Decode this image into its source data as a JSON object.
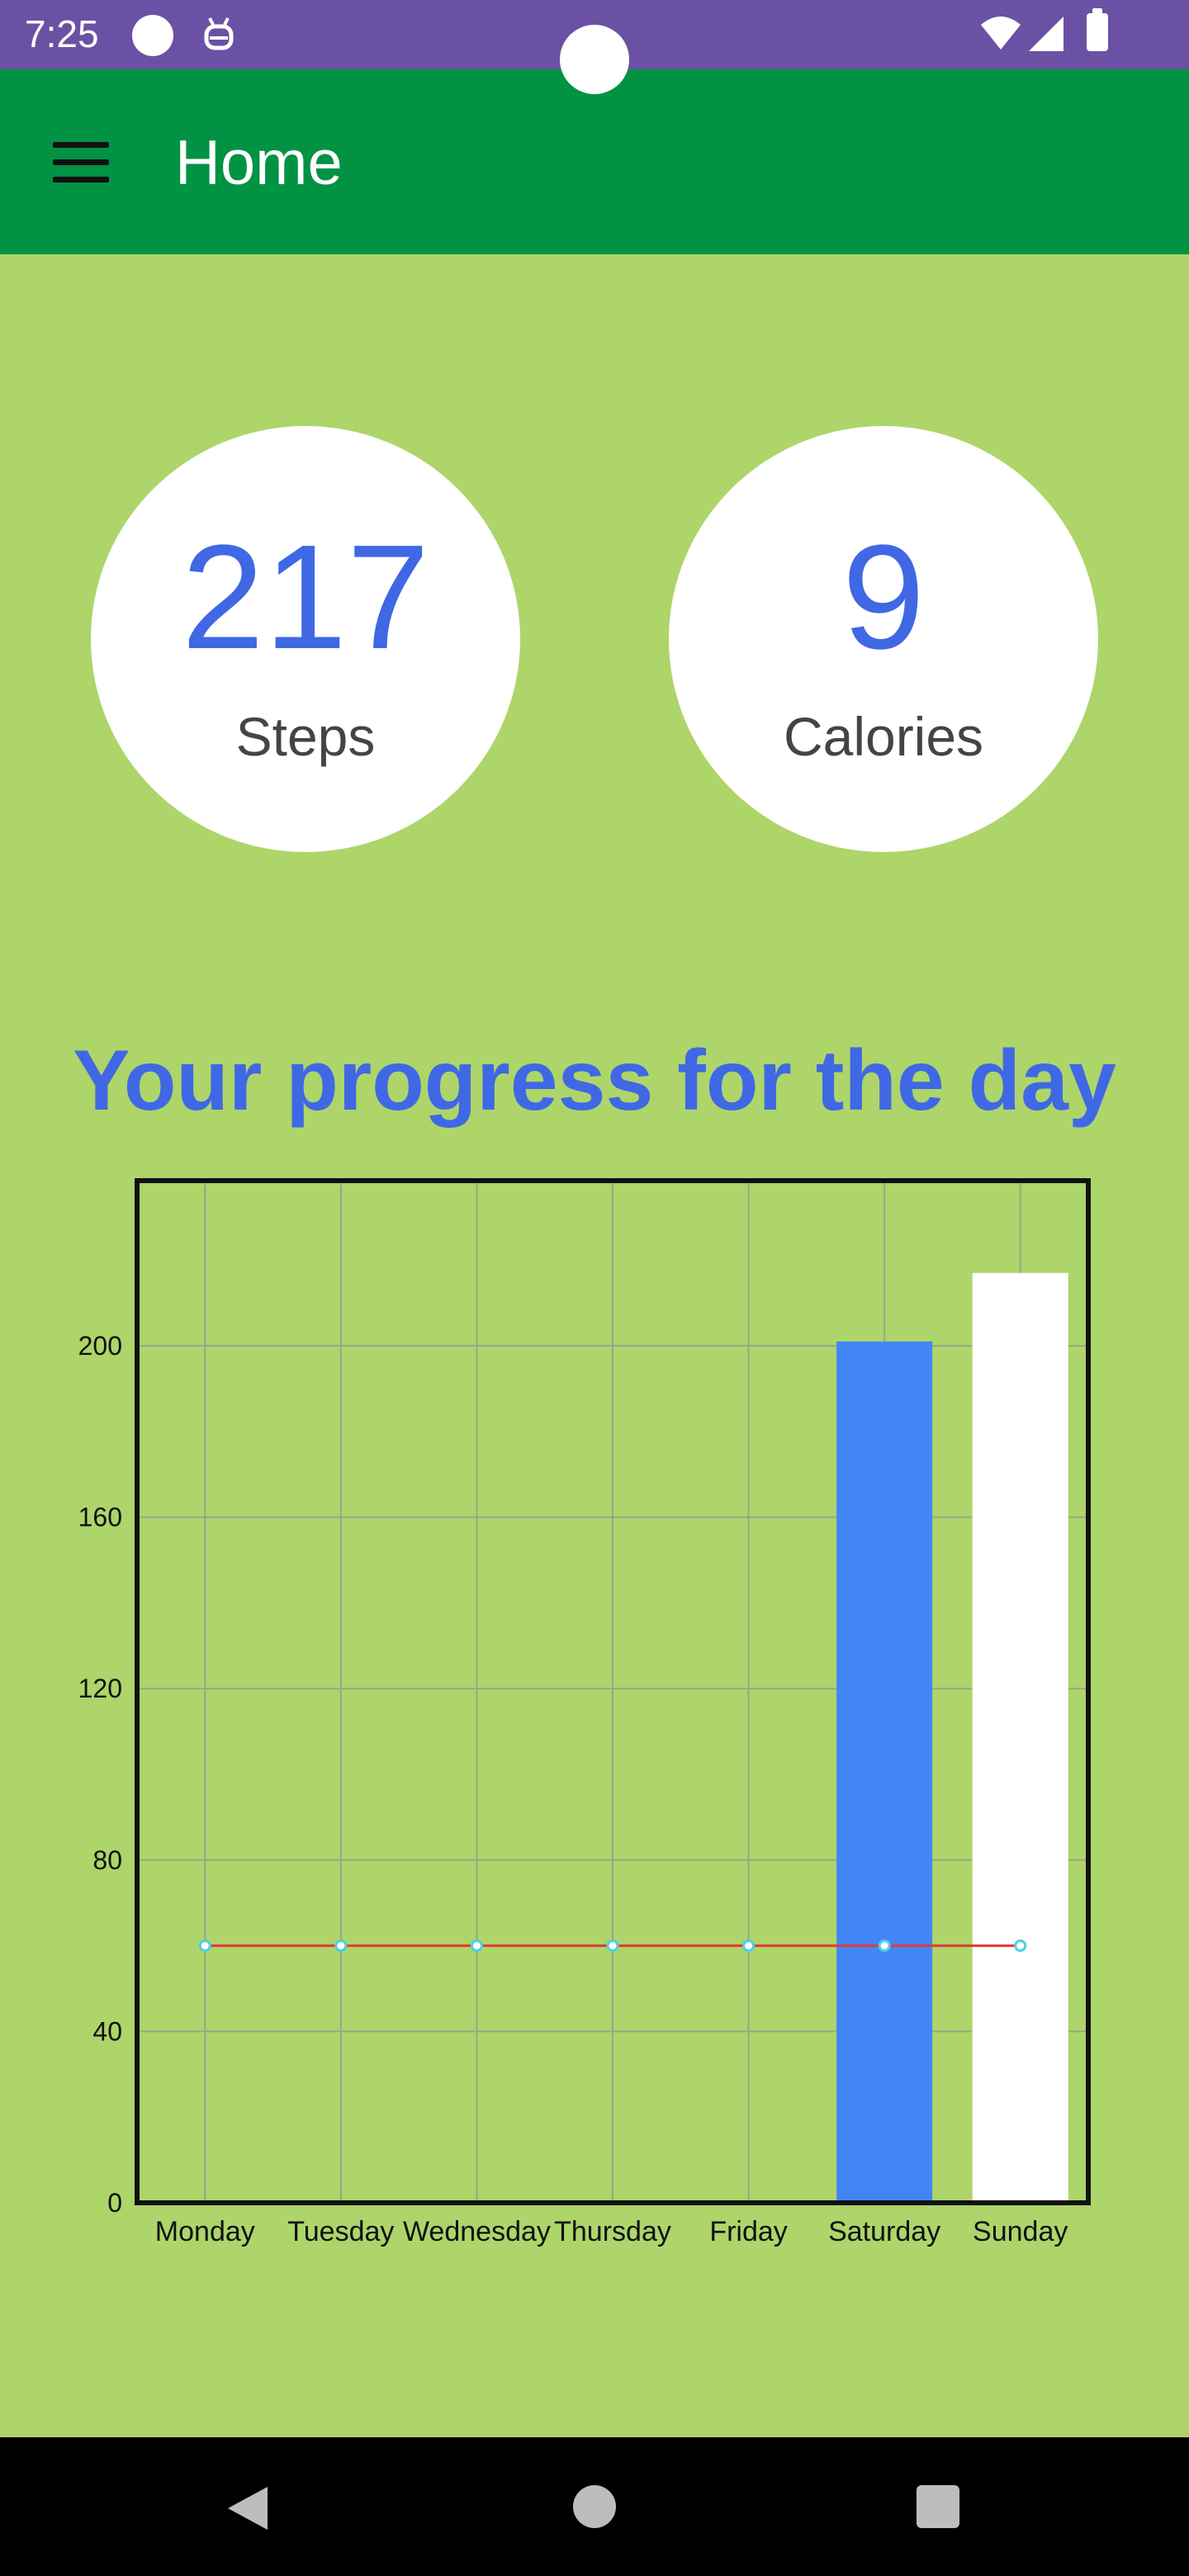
{
  "status_bar": {
    "time": "7:25"
  },
  "app_bar": {
    "title": "Home"
  },
  "stats": {
    "steps": {
      "value": "217",
      "label": "Steps"
    },
    "calories": {
      "value": "9",
      "label": "Calories"
    }
  },
  "progress_title": "Your progress for the day",
  "chart_data": {
    "type": "bar",
    "categories": [
      "Monday",
      "Tuesday",
      "Wednesday",
      "Thursday",
      "Friday",
      "Saturday",
      "Sunday"
    ],
    "series": [
      {
        "values": [
          0,
          0,
          0,
          0,
          0,
          201,
          217
        ],
        "colors": [
          "#4285f4",
          "#4285f4",
          "#4285f4",
          "#4285f4",
          "#4285f4",
          "#4285f4",
          "#ffffff"
        ]
      },
      {
        "type": "line",
        "values": [
          60,
          60,
          60,
          60,
          60,
          60,
          60
        ],
        "color": "#e53935"
      }
    ],
    "yticks": [
      0,
      40,
      80,
      120,
      160,
      200
    ],
    "ylim": [
      0,
      238
    ],
    "grid": true
  },
  "colors": {
    "accent": "#4068e4",
    "app_bar": "#019343",
    "status_bar": "#6a51a3",
    "background": "#add56a"
  }
}
